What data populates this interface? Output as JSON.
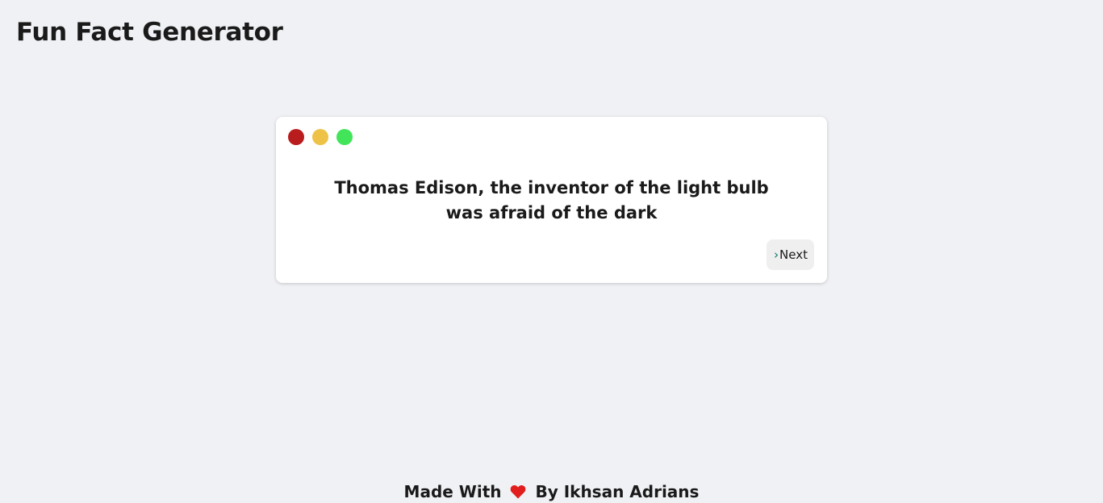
{
  "header": {
    "title": "Fun Fact Generator"
  },
  "card": {
    "window_dots": [
      {
        "name": "red-dot",
        "color": "#b91c1c"
      },
      {
        "name": "yellow-dot",
        "color": "#eec246"
      },
      {
        "name": "green-dot",
        "color": "#42e55a"
      }
    ],
    "fact": "Thomas Edison, the inventor of the light bulb was afraid of the dark",
    "next_icon": "chevron-right-icon",
    "next_icon_color": "#0f766e",
    "next_label": "Next"
  },
  "footer": {
    "prefix": "Made With",
    "icon": "heart-icon",
    "icon_color": "#e11d1d",
    "suffix": "By Ikhsan Adrians"
  }
}
